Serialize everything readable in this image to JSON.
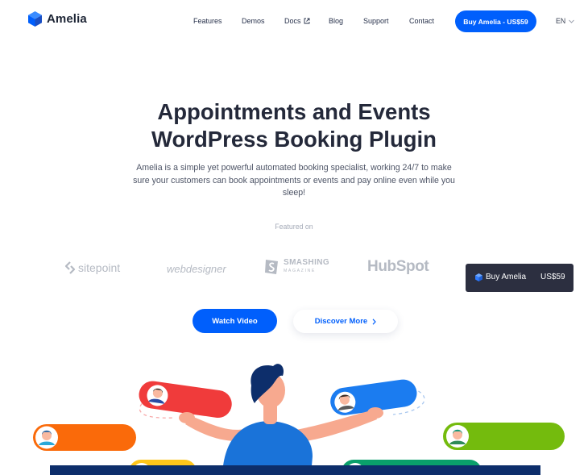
{
  "nav": {
    "brand": "Amelia",
    "items": [
      "Features",
      "Demos",
      "Docs",
      "Blog",
      "Support",
      "Contact"
    ],
    "cta": "Buy Amelia - US$59",
    "lang": "EN"
  },
  "hero": {
    "title_line1": "Appointments and Events",
    "title_line2": "WordPress Booking Plugin",
    "description": "Amelia is a simple yet powerful automated booking specialist, working 24/7 to make sure your customers can book appointments or events and pay online even while you sleep!",
    "featured_label": "Featured on"
  },
  "featured_brands": {
    "sitepoint": "sitepoint",
    "webdesigner": "webdesigner",
    "smashing_top": "SMASHING",
    "smashing_bottom": "MAGAZINE",
    "hubspot": "HubSpot"
  },
  "floating_buy": {
    "label": "Buy Amelia",
    "price": "US$59"
  },
  "buttons": {
    "watch": "Watch Video",
    "discover": "Discover More"
  },
  "icons": [
    "amelia-logo-icon",
    "external-link-icon",
    "chevron-down-icon",
    "sitepoint-logo-icon",
    "smashing-logo-icon",
    "chevron-right-icon"
  ],
  "colors": {
    "primary": "#005ffc",
    "dark": "#24293a",
    "floating_bg": "#2c2f40",
    "pill_red": "#f03b3b",
    "pill_blue": "#1b7cf0",
    "pill_orange": "#fa6a0a",
    "pill_green": "#74bb0d",
    "pill_yellow": "#ffc61a",
    "pill_teal": "#0aa06b",
    "person_hair": "#0d2e6b",
    "person_shirt": "#1a73d9",
    "skin": "#f7a98f"
  }
}
